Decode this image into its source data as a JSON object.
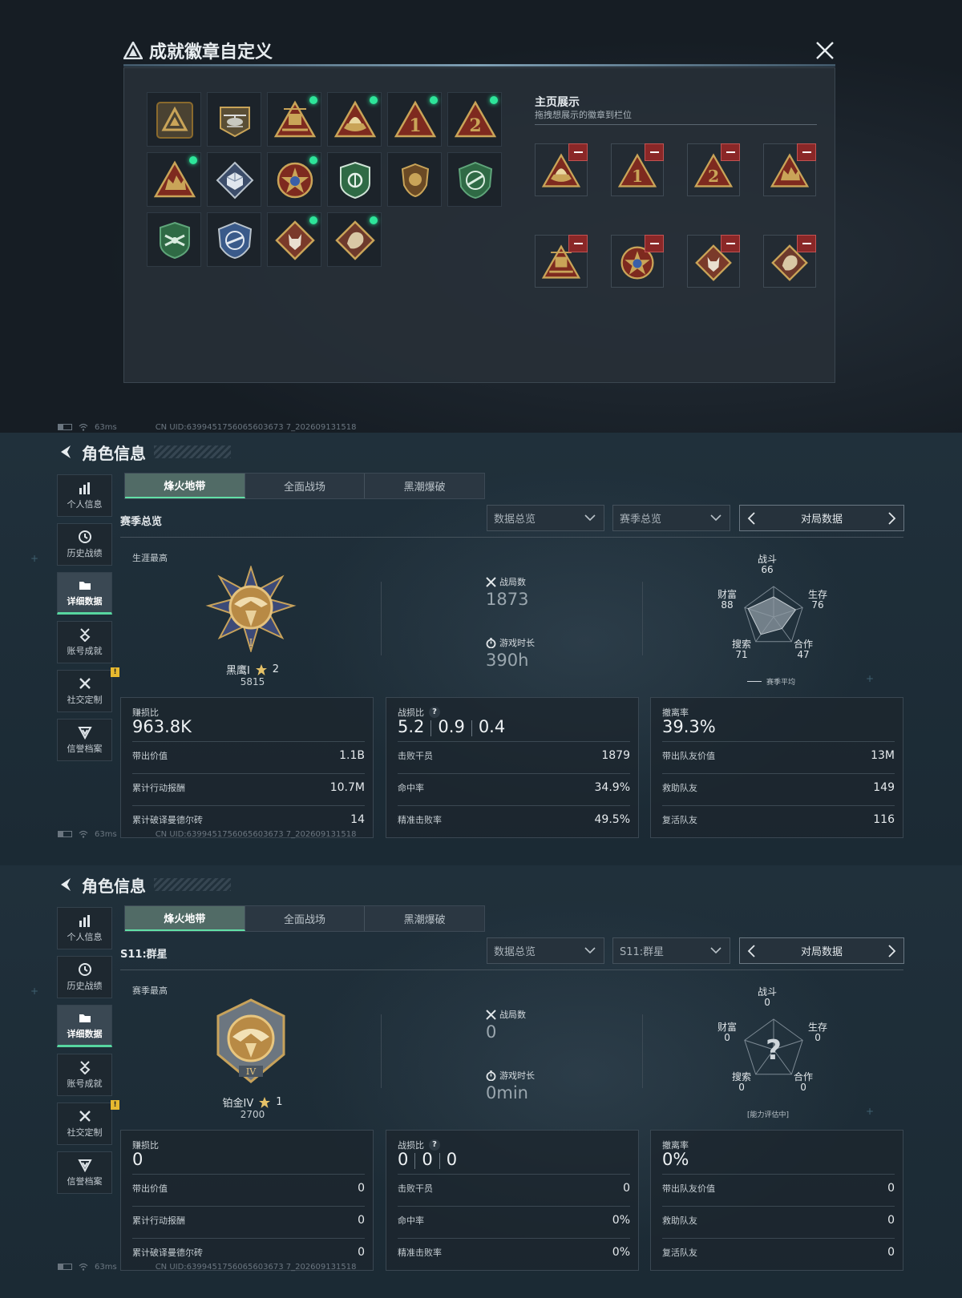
{
  "modal": {
    "title": "成就徽章自定义",
    "badges": [
      {
        "icon": "triangle-emblem-icon",
        "dot": false
      },
      {
        "icon": "helicopter-badge-icon",
        "dot": false
      },
      {
        "icon": "gold-turret-badge-icon",
        "dot": true
      },
      {
        "icon": "gold-ship-badge-icon",
        "dot": true
      },
      {
        "icon": "rank-1-badge-icon",
        "dot": true
      },
      {
        "icon": "rank-2-badge-icon",
        "dot": true
      },
      {
        "icon": "gold-beast-badge-icon",
        "dot": true
      },
      {
        "icon": "cube-diamond-badge-icon",
        "dot": false
      },
      {
        "icon": "star-wreath-badge-icon",
        "dot": true
      },
      {
        "icon": "green-shield-badge-icon",
        "dot": false
      },
      {
        "icon": "lion-shield-badge-icon",
        "dot": false
      },
      {
        "icon": "green-plane-badge-icon",
        "dot": false
      },
      {
        "icon": "green-wings-badge-icon",
        "dot": false
      },
      {
        "icon": "blue-plane-badge-icon",
        "dot": false
      },
      {
        "icon": "wolf-diamond-badge-icon",
        "dot": true
      },
      {
        "icon": "dragon-diamond-badge-icon",
        "dot": true
      }
    ],
    "showcase": {
      "title": "主页展示",
      "subtitle": "拖拽想展示的徽章到栏位",
      "slots": [
        "gold-ship-badge-icon",
        "rank-1-badge-icon",
        "rank-2-badge-icon",
        "gold-beast-badge-icon",
        "gold-turret-badge-icon",
        "star-wreath-badge-icon",
        "wolf-diamond-badge-icon",
        "dragon-diamond-badge-icon"
      ]
    }
  },
  "statusbar": {
    "ping": "63ms",
    "uid": "CN UID:6399451756065603673 7_202609131518"
  },
  "panels": [
    {
      "title": "角色信息",
      "sidebar": [
        "个人信息",
        "历史战绩",
        "详细数据",
        "账号成就",
        "社交定制",
        "信誉档案"
      ],
      "tabs": [
        "烽火地带",
        "全面战场",
        "黑潮爆破"
      ],
      "season_label": "赛季总览",
      "dropdown1": "数据总览",
      "dropdown2": "赛季总览",
      "match_nav": "对局数据",
      "best_label": "生涯最高",
      "rank_name": "黑鹰I",
      "rank_stars": "2",
      "rank_score": "5815",
      "matches_label": "战局数",
      "matches": "1873",
      "time_label": "游戏时长",
      "time": "390h",
      "radar": {
        "combat_label": "战斗",
        "combat": "66",
        "survive_label": "生存",
        "survive": "76",
        "coop_label": "合作",
        "coop": "47",
        "search_label": "搜索",
        "search": "71",
        "wealth_label": "财富",
        "wealth": "88",
        "legend": "赛季平均",
        "values": [
          66,
          76,
          47,
          71,
          88
        ],
        "max": 100
      },
      "card1": {
        "label": "赚损比",
        "big": "963.8K",
        "rows": [
          [
            "带出价值",
            "1.1B"
          ],
          [
            "累计行动报酬",
            "10.7M"
          ],
          [
            "累计破译曼德尔砖",
            "14"
          ]
        ]
      },
      "card2": {
        "label": "战损比",
        "big": [
          "5.2",
          "0.9",
          "0.4"
        ],
        "rows": [
          [
            "击败干员",
            "1879"
          ],
          [
            "命中率",
            "34.9%"
          ],
          [
            "精准击败率",
            "49.5%"
          ]
        ]
      },
      "card3": {
        "label": "撤离率",
        "big": "39.3%",
        "rows": [
          [
            "带出队友价值",
            "13M"
          ],
          [
            "救助队友",
            "149"
          ],
          [
            "复活队友",
            "116"
          ]
        ]
      }
    },
    {
      "title": "角色信息",
      "sidebar": [
        "个人信息",
        "历史战绩",
        "详细数据",
        "账号成就",
        "社交定制",
        "信誉档案"
      ],
      "tabs": [
        "烽火地带",
        "全面战场",
        "黑潮爆破"
      ],
      "season_label": "S11:群星",
      "dropdown1": "数据总览",
      "dropdown2": "S11:群星",
      "match_nav": "对局数据",
      "best_label": "赛季最高",
      "rank_name": "铂金IV",
      "rank_stars": "1",
      "rank_score": "2700",
      "matches_label": "战局数",
      "matches": "0",
      "time_label": "游戏时长",
      "time": "0min",
      "radar": {
        "combat_label": "战斗",
        "combat": "0",
        "survive_label": "生存",
        "survive": "0",
        "coop_label": "合作",
        "coop": "0",
        "search_label": "搜索",
        "search": "0",
        "wealth_label": "财富",
        "wealth": "0",
        "legend": "[能力评估中]",
        "values": [
          0,
          0,
          0,
          0,
          0
        ],
        "max": 100
      },
      "card1": {
        "label": "赚损比",
        "big": "0",
        "rows": [
          [
            "带出价值",
            "0"
          ],
          [
            "累计行动报酬",
            "0"
          ],
          [
            "累计破译曼德尔砖",
            "0"
          ]
        ]
      },
      "card2": {
        "label": "战损比",
        "big": [
          "0",
          "0",
          "0"
        ],
        "rows": [
          [
            "击败干员",
            "0"
          ],
          [
            "命中率",
            "0%"
          ],
          [
            "精准击败率",
            "0%"
          ]
        ]
      },
      "card3": {
        "label": "撤离率",
        "big": "0%",
        "rows": [
          [
            "带出队友价值",
            "0"
          ],
          [
            "救助队友",
            "0"
          ],
          [
            "复活队友",
            "0"
          ]
        ]
      }
    }
  ],
  "colors": {
    "accent": "#57d6a0",
    "badge_new_dot": "#2ee59a",
    "remove": "#8a2727",
    "warn": "#e6b92f"
  }
}
